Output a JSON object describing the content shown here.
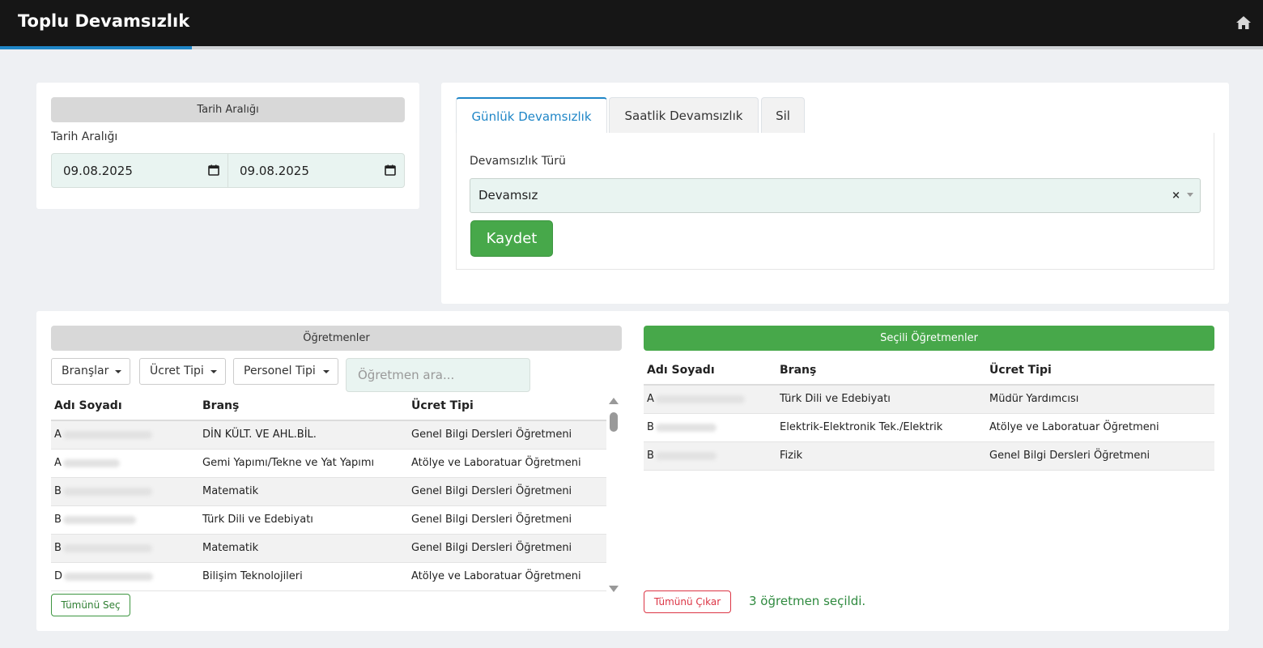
{
  "header": {
    "title": "Toplu Devamsızlık"
  },
  "date_range": {
    "header": "Tarih Aralığı",
    "label": "Tarih Aralığı",
    "start": "09.08.2025",
    "end": "09.08.2025"
  },
  "tabs": [
    {
      "label": "Günlük Devamsızlık",
      "active": true
    },
    {
      "label": "Saatlik Devamsızlık",
      "active": false
    },
    {
      "label": "Sil",
      "active": false
    }
  ],
  "attendance": {
    "type_label": "Devamsızlık Türü",
    "type_value": "Devamsız",
    "clear_glyph": "×",
    "save_label": "Kaydet"
  },
  "teachers": {
    "header": "Öğretmenler",
    "filters": {
      "branches": "Branşlar",
      "fee_type": "Ücret Tipi",
      "staff_type": "Personel Tipi"
    },
    "search_placeholder": "Öğretmen ara...",
    "columns": [
      "Adı Soyadı",
      "Branş",
      "Ücret Tipi"
    ],
    "rows": [
      {
        "initial": "A",
        "branch": "DİN KÜLT. VE AHL.BİL.",
        "fee": "Genel Bilgi Dersleri Öğretmeni"
      },
      {
        "initial": "A",
        "branch": "Gemi Yapımı/Tekne ve Yat Yapımı",
        "fee": "Atölye ve Laboratuar Öğretmeni"
      },
      {
        "initial": "B",
        "branch": "Matematik",
        "fee": "Genel Bilgi Dersleri Öğretmeni"
      },
      {
        "initial": "B",
        "branch": "Türk Dili ve Edebiyatı",
        "fee": "Genel Bilgi Dersleri Öğretmeni"
      },
      {
        "initial": "B",
        "branch": "Matematik",
        "fee": "Genel Bilgi Dersleri Öğretmeni"
      },
      {
        "initial": "D",
        "branch": "Bilişim Teknolojileri",
        "fee": "Atölye ve Laboratuar Öğretmeni"
      }
    ],
    "select_all_label": "Tümünü Seç"
  },
  "selected": {
    "header": "Seçili Öğretmenler",
    "columns": [
      "Adı Soyadı",
      "Branş",
      "Ücret Tipi"
    ],
    "rows": [
      {
        "initial": "A",
        "branch": "Türk Dili ve Edebiyatı",
        "fee": "Müdür Yardımcısı"
      },
      {
        "initial": "B",
        "branch": "Elektrik-Elektronik Tek./Elektrik",
        "fee": "Atölye ve Laboratuar Öğretmeni"
      },
      {
        "initial": "B",
        "branch": "Fizik",
        "fee": "Genel Bilgi Dersleri Öğretmeni"
      }
    ],
    "remove_all_label": "Tümünü Çıkar",
    "status": "3 öğretmen seçildi."
  },
  "colors": {
    "accent": "#1f86c7",
    "success": "#47a84a",
    "danger": "#dc3545",
    "topbar": "#161616"
  },
  "icons": {
    "home": "home-icon",
    "calendar": "calendar-icon",
    "caret": "caret-down-icon"
  }
}
